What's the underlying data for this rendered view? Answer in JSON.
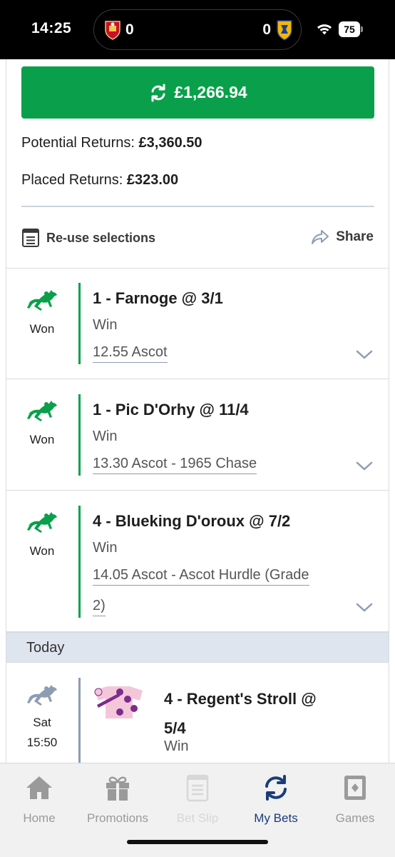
{
  "status_bar": {
    "time": "14:25",
    "score_left": "0",
    "score_right": "0",
    "battery": "75"
  },
  "bet_summary": {
    "cashout_amount": "£1,266.94",
    "potential_returns_label": "Potential Returns:",
    "potential_returns_value": "£3,360.50",
    "placed_returns_label": "Placed Returns:",
    "placed_returns_value": "£323.00",
    "reuse_label": "Re-use selections",
    "share_label": "Share"
  },
  "selections": [
    {
      "status": "Won",
      "title": "1 - Farnoge @ 3/1",
      "market": "Win",
      "event": "12.55 Ascot"
    },
    {
      "status": "Won",
      "title": "1 - Pic D'Orhy @ 11/4",
      "market": "Win",
      "event": "13.30 Ascot - 1965 Chase"
    },
    {
      "status": "Won",
      "title": "4 - Blueking D'oroux @ 7/2",
      "market": "Win",
      "event_line1": "14.05 Ascot - Ascot Hurdle (Grade",
      "event_line2": "2)"
    }
  ],
  "today_section": {
    "heading": "Today",
    "selection": {
      "day": "Sat",
      "time": "15:50",
      "title_line1": "4 - Regent's Stroll @",
      "title_line2": "5/4",
      "market": "Win"
    }
  },
  "bottom_nav": [
    {
      "label": "Home",
      "icon": "home-icon",
      "state": "normal"
    },
    {
      "label": "Promotions",
      "icon": "gift-icon",
      "state": "normal"
    },
    {
      "label": "Bet Slip",
      "icon": "betslip-icon",
      "state": "disabled"
    },
    {
      "label": "My Bets",
      "icon": "refresh-arrows-icon",
      "state": "active"
    },
    {
      "label": "Games",
      "icon": "games-card-icon",
      "state": "normal"
    }
  ],
  "colors": {
    "brand_green": "#0aa04b",
    "active_nav": "#1a3c7c",
    "pending_gray": "#8e9cb3",
    "section_bg": "#dfe5ee"
  }
}
